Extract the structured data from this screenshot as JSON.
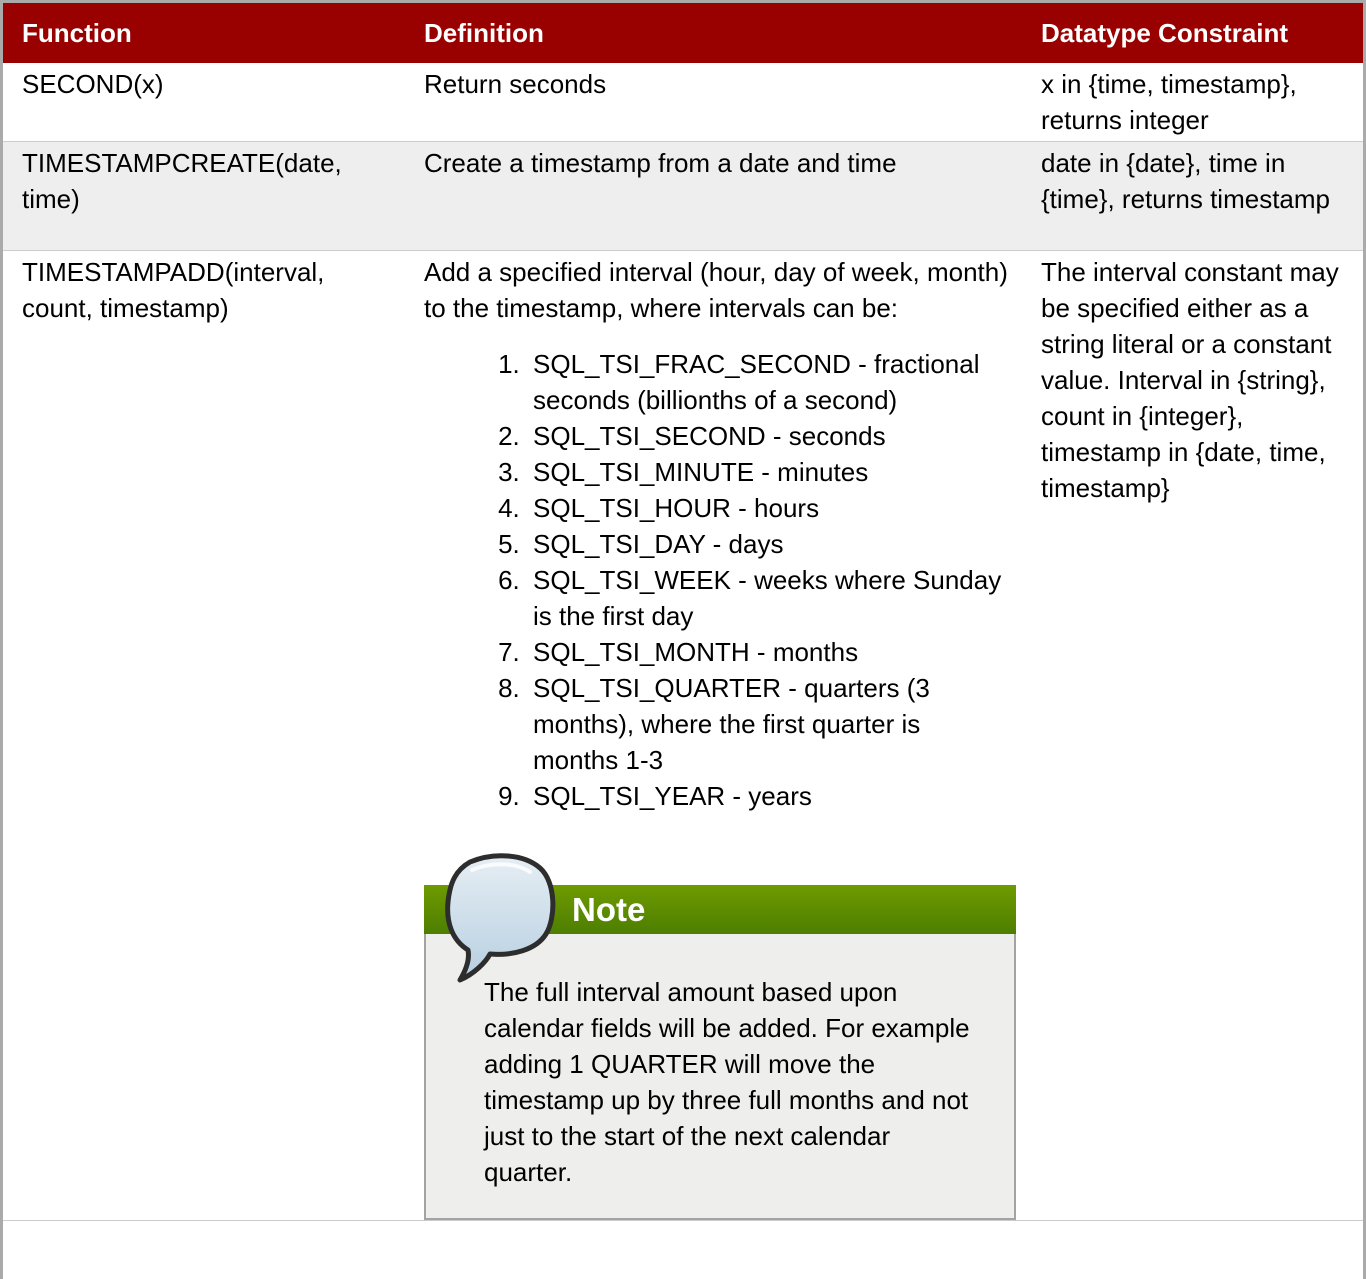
{
  "table": {
    "headers": [
      "Function",
      "Definition",
      "Datatype Constraint"
    ],
    "rows": [
      {
        "function": "SECOND(x)",
        "definition": "Return seconds",
        "constraint": "x in {time, timestamp}, returns integer"
      },
      {
        "function": "TIMESTAMPCREATE(date, time)",
        "definition": "Create a timestamp from a date and time",
        "constraint": "date in {date}, time in {time}, returns timestamp"
      },
      {
        "function": "TIMESTAMPADD(interval, count, timestamp)",
        "definition": "Add a specified interval (hour, day of week, month) to the timestamp, where intervals can be:",
        "intervals": [
          "SQL_TSI_FRAC_SECOND - fractional seconds (billionths of a second)",
          "SQL_TSI_SECOND - seconds",
          "SQL_TSI_MINUTE - minutes",
          "SQL_TSI_HOUR - hours",
          "SQL_TSI_DAY - days",
          "SQL_TSI_WEEK - weeks where Sunday is the first day",
          "SQL_TSI_MONTH - months",
          "SQL_TSI_QUARTER - quarters (3 months), where the first quarter is months 1-3",
          "SQL_TSI_YEAR - years"
        ],
        "note": {
          "title": "Note",
          "icon": "speech-bubble-icon",
          "text": "The full interval amount based upon calendar fields will be added. For example adding 1 QUARTER will move the timestamp up by three full months and not just to the start of the next calendar quarter."
        },
        "constraint": "The interval constant may be specified either as a string literal or a constant value. Interval in {string}, count in {integer}, timestamp in {date, time, timestamp}"
      }
    ]
  },
  "colors": {
    "header_bg": "#990000",
    "note_header": "#5a8a00",
    "alt_row": "#eeeeee"
  }
}
